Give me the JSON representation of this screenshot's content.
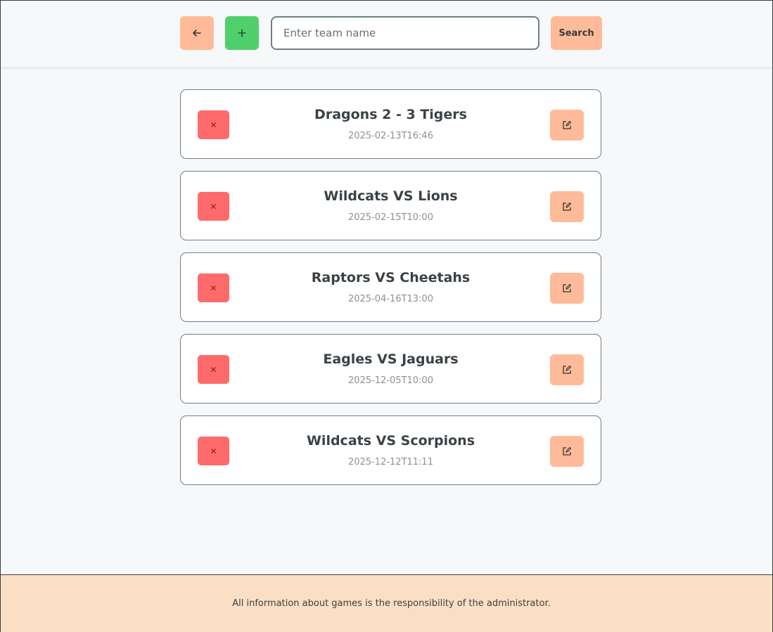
{
  "header": {
    "back_icon": "arrow-left-icon",
    "add_icon": "plus-icon",
    "search_placeholder": "Enter team name",
    "search_value": "",
    "search_label": "Search"
  },
  "games": [
    {
      "title": "Dragons 2 - 3 Tigers",
      "date": "2025-02-13T16:46"
    },
    {
      "title": "Wildcats VS Lions",
      "date": "2025-02-15T10:00"
    },
    {
      "title": "Raptors VS Cheetahs",
      "date": "2025-04-16T13:00"
    },
    {
      "title": "Eagles VS Jaguars",
      "date": "2025-12-05T10:00"
    },
    {
      "title": "Wildcats VS Scorpions",
      "date": "2025-12-12T11:11"
    }
  ],
  "footer": {
    "text": "All information about games is the responsibility of the administrator."
  },
  "colors": {
    "accent_peach": "#ffbb99",
    "add_green": "#4fd06a",
    "delete_red": "#ff6b6b",
    "footer_bg": "#fbdfc4"
  }
}
